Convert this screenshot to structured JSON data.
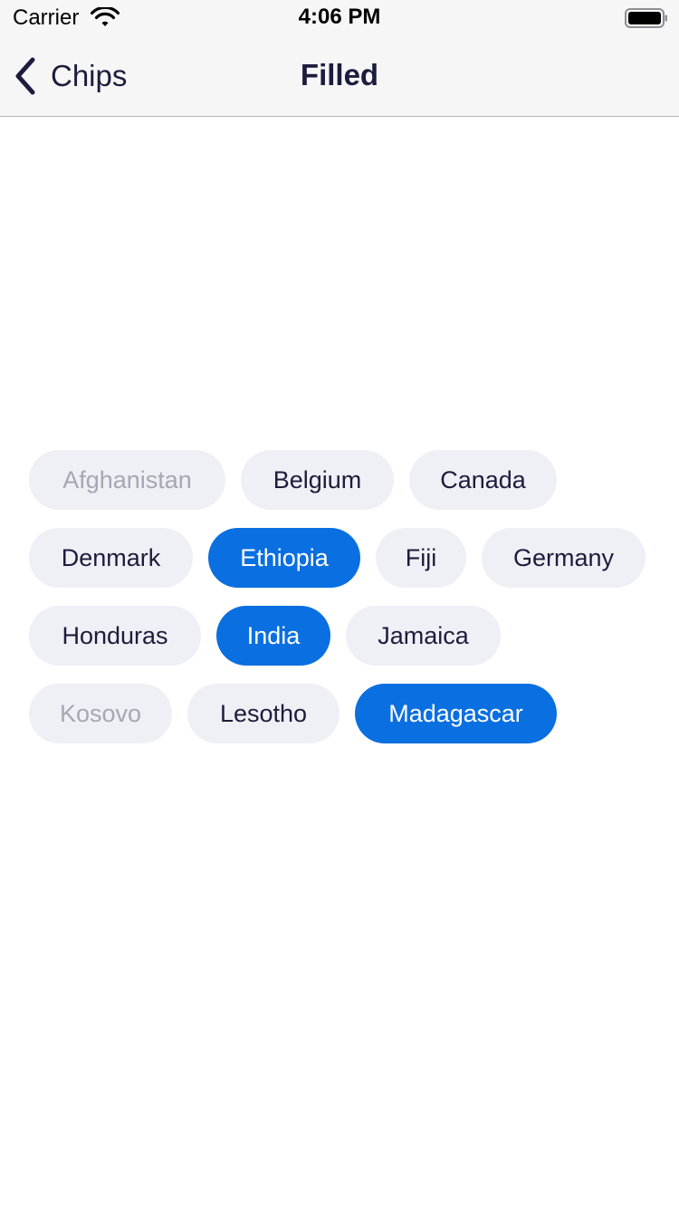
{
  "status_bar": {
    "carrier": "Carrier",
    "time": "4:06 PM",
    "wifi_icon": "wifi-icon",
    "battery_icon": "battery-icon"
  },
  "nav": {
    "back_label": "Chips",
    "back_icon": "chevron-left-icon",
    "title": "Filled"
  },
  "colors": {
    "accent": "#0a6fe0",
    "chip_background": "#eff0f5",
    "text": "#1c1c3c",
    "disabled_text": "#a6a7b3"
  },
  "chips": [
    {
      "label": "Afghanistan",
      "state": "disabled"
    },
    {
      "label": "Belgium",
      "state": "default"
    },
    {
      "label": "Canada",
      "state": "default"
    },
    {
      "label": "Denmark",
      "state": "default"
    },
    {
      "label": "Ethiopia",
      "state": "selected"
    },
    {
      "label": "Fiji",
      "state": "default"
    },
    {
      "label": "Germany",
      "state": "default"
    },
    {
      "label": "Honduras",
      "state": "default"
    },
    {
      "label": "India",
      "state": "selected"
    },
    {
      "label": "Jamaica",
      "state": "default"
    },
    {
      "label": "Kosovo",
      "state": "disabled"
    },
    {
      "label": "Lesotho",
      "state": "default"
    },
    {
      "label": "Madagascar",
      "state": "selected"
    }
  ]
}
